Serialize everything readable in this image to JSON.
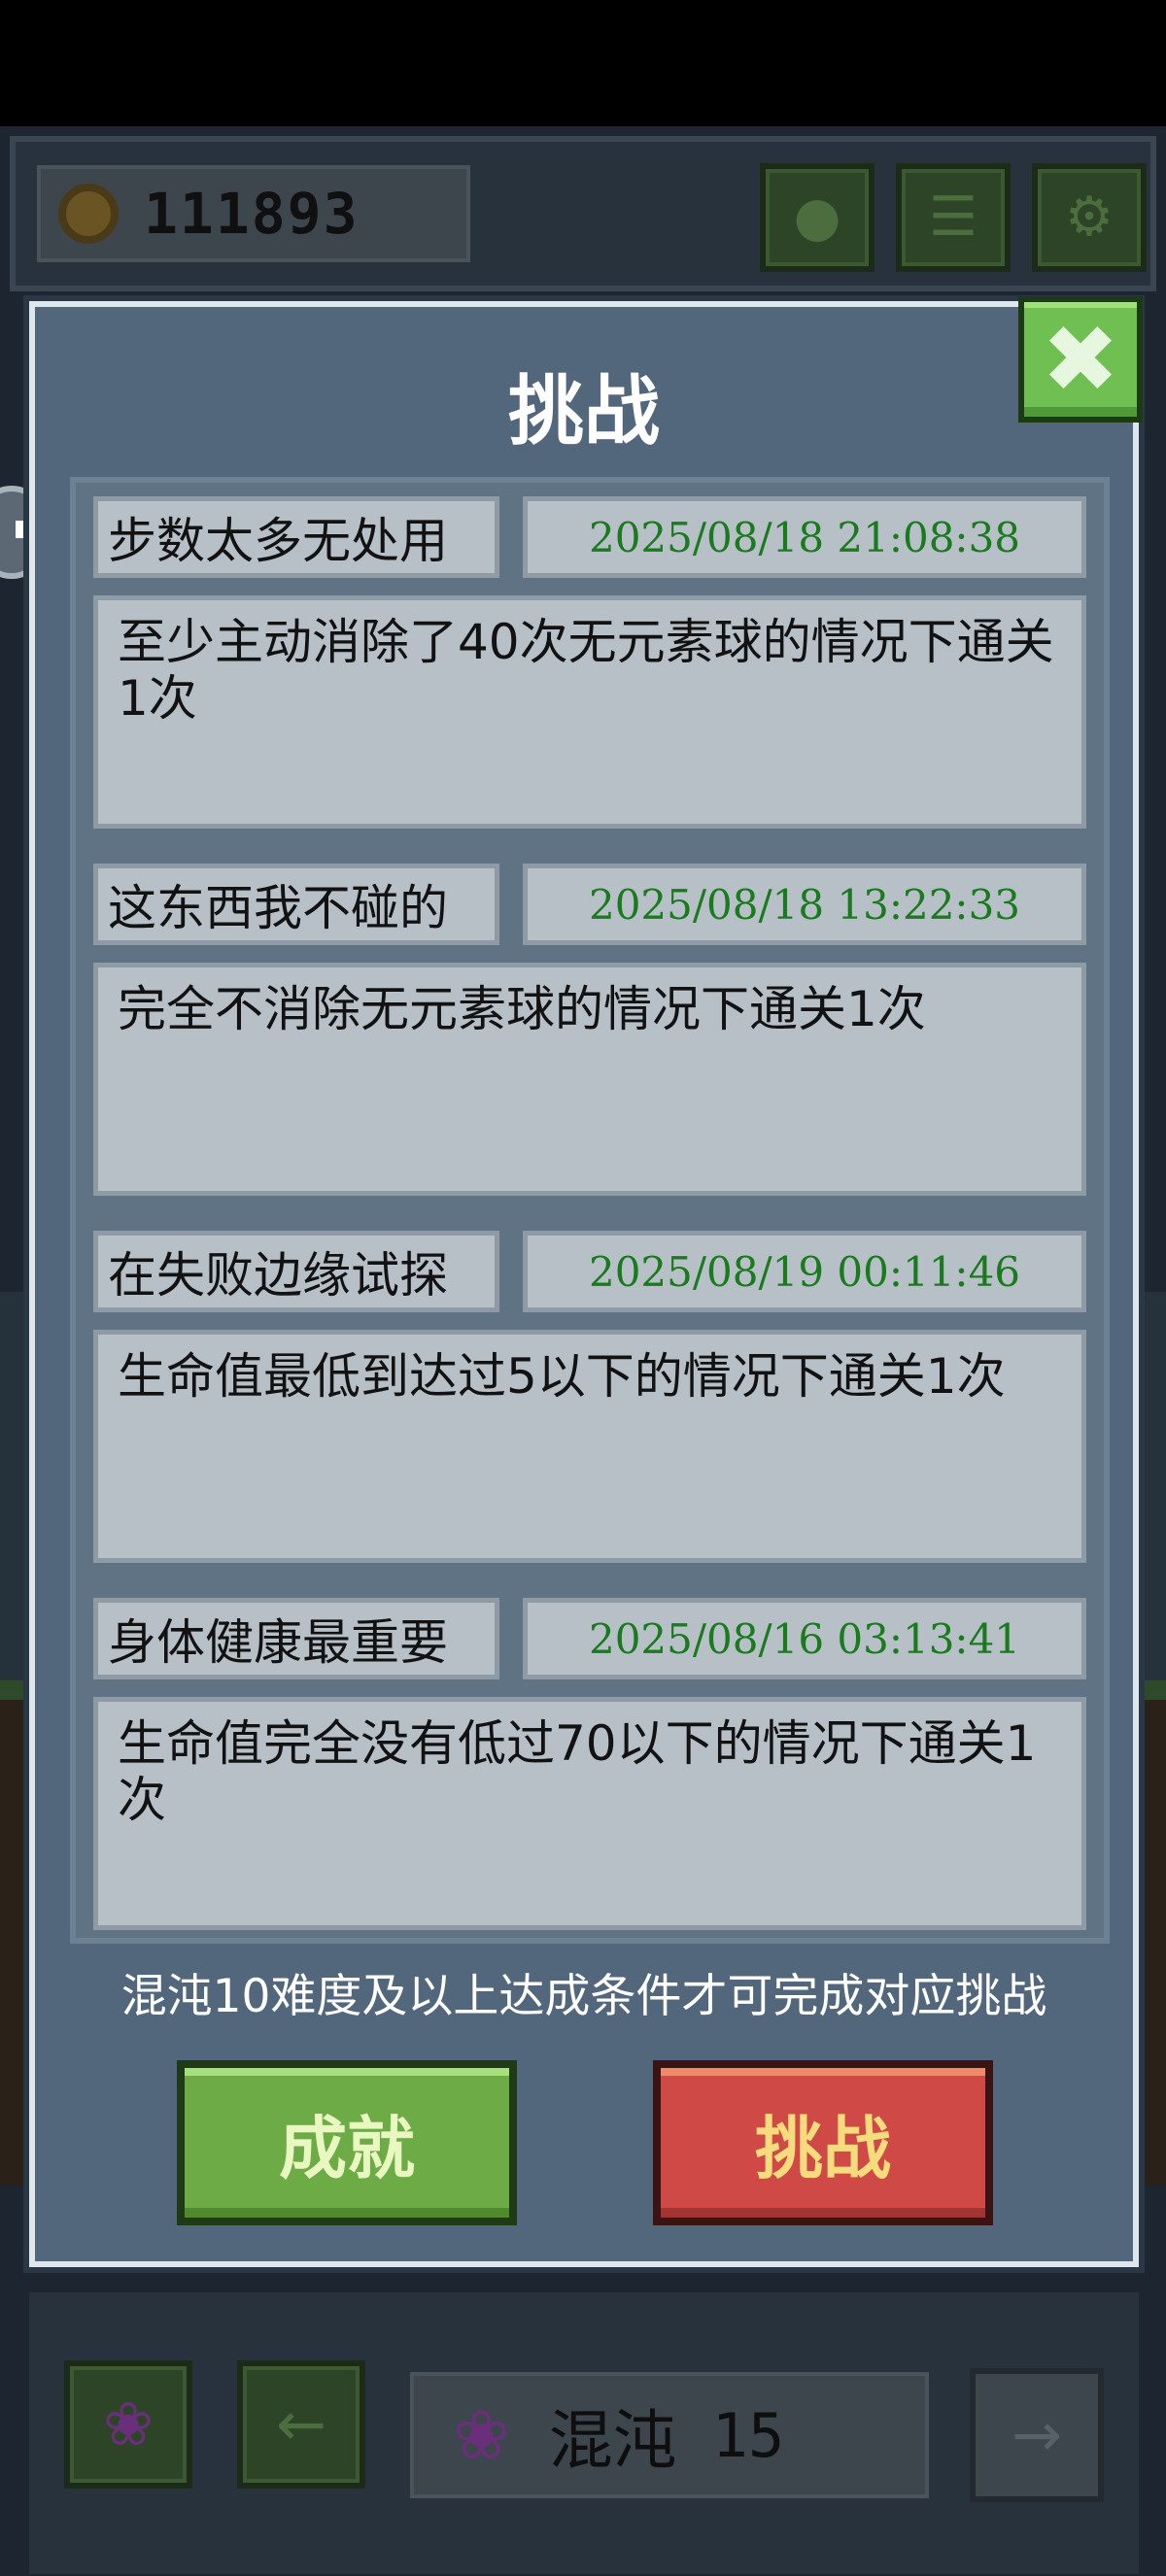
{
  "topbar": {
    "coins": "111893",
    "icons": [
      "trophy-icon",
      "list-icon",
      "gear-icon"
    ]
  },
  "dialog": {
    "title": "挑战",
    "close_icon": "close-icon",
    "challenges": [
      {
        "name": "步数太多无处用",
        "date": "2025/08/18 21:08:38",
        "description": "至少主动消除了40次无元素球的情况下通关1次"
      },
      {
        "name": "这东西我不碰的",
        "date": "2025/08/18 13:22:33",
        "description": "完全不消除无元素球的情况下通关1次"
      },
      {
        "name": "在失败边缘试探",
        "date": "2025/08/19 00:11:46",
        "description": "生命值最低到达过5以下的情况下通关1次"
      },
      {
        "name": "身体健康最重要",
        "date": "2025/08/16 03:13:41",
        "description": "生命值完全没有低过70以下的情况下通关1次"
      }
    ],
    "footer_note": "混沌10难度及以上达成条件才可完成对应挑战",
    "achievements_button": "成就",
    "challenges_button": "挑战"
  },
  "bottombar": {
    "mode_label": "混沌",
    "mode_level": "15"
  },
  "colors": {
    "date_text": "#1a7a1e",
    "green_button": "#6dab46",
    "red_button": "#cf4a46",
    "dialog_bg": "#52677b"
  }
}
